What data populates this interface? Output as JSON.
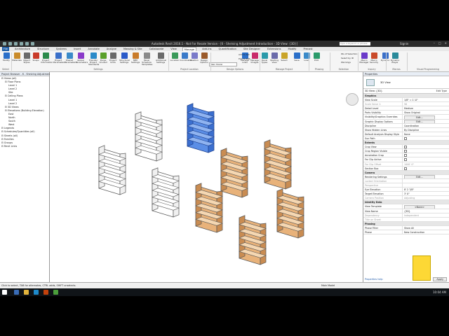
{
  "window": {
    "title": "Autodesk Revit 2016.1 - Not For Resale Version - [6 - Shelving Adjustment Introduction - 3D View: {3D}]",
    "search_placeholder": "Type a keyword or phrase",
    "user": "Signin"
  },
  "tabs": [
    "File",
    "Architecture",
    "Structure",
    "Systems",
    "Insert",
    "Annotate",
    "Analyze",
    "Massing & Site",
    "Collaborate",
    "View",
    "Manage",
    "Add-Ins",
    "Quantification",
    "Site Designer",
    "Extensions",
    "Modify",
    "Precast"
  ],
  "active_tab": "Manage",
  "ribbon": {
    "buttons": [
      {
        "label": "Modify"
      },
      {
        "label": "Materials"
      },
      {
        "label": "Object Styles"
      },
      {
        "label": "Snaps"
      },
      {
        "label": "Project Information"
      },
      {
        "label": "Project Parameters"
      },
      {
        "label": "Shared Parameters"
      },
      {
        "label": "Global Parameters"
      },
      {
        "label": "Transfer Project Standards"
      },
      {
        "label": "Purge Unused"
      },
      {
        "label": "Project Units"
      },
      {
        "label": "Structural Settings"
      },
      {
        "label": "MEP Settings"
      },
      {
        "label": "Panel Schedule Templates"
      },
      {
        "label": "Additional Settings"
      },
      {
        "label": "Location"
      },
      {
        "label": "Coordinates"
      },
      {
        "label": "Position"
      },
      {
        "label": "Design Options"
      },
      {
        "label": "Main Model"
      },
      {
        "label": "Manage Links"
      },
      {
        "label": "Manage Images"
      },
      {
        "label": "Decal Types"
      },
      {
        "label": "Starting View"
      },
      {
        "label": "Select"
      },
      {
        "label": "Save"
      },
      {
        "label": "Load"
      },
      {
        "label": "Edit"
      },
      {
        "label": "Macro Manager"
      },
      {
        "label": "Macro Security"
      },
      {
        "label": "Dynamo"
      },
      {
        "label": "Dynamo Player"
      }
    ],
    "small_items": [
      "Add to Set",
      "Pick to Edit",
      "IDs of Selection",
      "Select by ID",
      "Warnings"
    ],
    "groups": [
      "Select",
      "Settings",
      "Project Location",
      "Design Options",
      "Manage Project",
      "Phasing",
      "Selection",
      "Inquiry",
      "Macros",
      "Visual Programming"
    ]
  },
  "project_browser": {
    "title": "Project Browser - 6 - Shelving Adjustment Intro",
    "items": [
      {
        "label": "Views (all)",
        "level": 0
      },
      {
        "label": "Floor Plans",
        "level": 1
      },
      {
        "label": "Level 1",
        "level": 2
      },
      {
        "label": "Level 2",
        "level": 2
      },
      {
        "label": "Site",
        "level": 2
      },
      {
        "label": "Ceiling Plans",
        "level": 1
      },
      {
        "label": "Level 1",
        "level": 2
      },
      {
        "label": "Level 2",
        "level": 2
      },
      {
        "label": "3D Views",
        "level": 1
      },
      {
        "label": "Elevations (Building Elevation)",
        "level": 1
      },
      {
        "label": "East",
        "level": 2
      },
      {
        "label": "North",
        "level": 2
      },
      {
        "label": "South",
        "level": 2
      },
      {
        "label": "West",
        "level": 2
      },
      {
        "label": "Legends",
        "level": 0
      },
      {
        "label": "Schedules/Quantities (all)",
        "level": 0
      },
      {
        "label": "Sheets (all)",
        "level": 0
      },
      {
        "label": "Families",
        "level": 0
      },
      {
        "label": "Groups",
        "level": 0
      },
      {
        "label": "Revit Links",
        "level": 0
      }
    ]
  },
  "properties": {
    "title": "Properties",
    "type": "3D View",
    "view_selector": "3D View: {3D}",
    "edit_type": "Edit Type",
    "rows": [
      {
        "k": "Graphics",
        "v": "",
        "kind": "section"
      },
      {
        "k": "View Scale",
        "v": "1/8\" = 1'-0\"",
        "kind": "text"
      },
      {
        "k": "Scale Value  1:",
        "v": "96",
        "kind": "grey"
      },
      {
        "k": "Detail Level",
        "v": "Medium",
        "kind": "text"
      },
      {
        "k": "Parts Visibility",
        "v": "Show Original",
        "kind": "text"
      },
      {
        "k": "Visibility/Graphics Overrides",
        "v": "Edit...",
        "kind": "button"
      },
      {
        "k": "Graphic Display Options",
        "v": "Edit...",
        "kind": "button"
      },
      {
        "k": "Discipline",
        "v": "Coordination",
        "kind": "text"
      },
      {
        "k": "Show Hidden Lines",
        "v": "By Discipline",
        "kind": "text"
      },
      {
        "k": "Default Analysis Display Style",
        "v": "None",
        "kind": "text"
      },
      {
        "k": "Sun Path",
        "v": "",
        "kind": "check"
      },
      {
        "k": "Extents",
        "v": "",
        "kind": "section"
      },
      {
        "k": "Crop View",
        "v": "",
        "kind": "check"
      },
      {
        "k": "Crop Region Visible",
        "v": "",
        "kind": "check"
      },
      {
        "k": "Annotation Crop",
        "v": "",
        "kind": "check"
      },
      {
        "k": "Far Clip Active",
        "v": "",
        "kind": "check"
      },
      {
        "k": "Far Clip Offset",
        "v": "1000' 0\"",
        "kind": "grey"
      },
      {
        "k": "Section Box",
        "v": "",
        "kind": "check"
      },
      {
        "k": "Camera",
        "v": "",
        "kind": "section"
      },
      {
        "k": "Rendering Settings",
        "v": "Edit...",
        "kind": "button"
      },
      {
        "k": "Locked Orientation",
        "v": "",
        "kind": "grey"
      },
      {
        "k": "Perspective",
        "v": "",
        "kind": "grey"
      },
      {
        "k": "Eye Elevation",
        "v": "8' 2 7/8\"",
        "kind": "text"
      },
      {
        "k": "Target Elevation",
        "v": "3' 0\"",
        "kind": "text"
      },
      {
        "k": "Camera Position",
        "v": "Adjusting",
        "kind": "grey"
      },
      {
        "k": "Identity Data",
        "v": "",
        "kind": "section"
      },
      {
        "k": "View Template",
        "v": "<None>",
        "kind": "button"
      },
      {
        "k": "View Name",
        "v": "{3D}",
        "kind": "text"
      },
      {
        "k": "Dependency",
        "v": "Independent",
        "kind": "grey"
      },
      {
        "k": "Title on Sheet",
        "v": "",
        "kind": "grey"
      },
      {
        "k": "Phasing",
        "v": "",
        "kind": "section"
      },
      {
        "k": "Phase Filter",
        "v": "Show All",
        "kind": "text"
      },
      {
        "k": "Phase",
        "v": "New Construction",
        "kind": "text"
      }
    ],
    "help": "Properties help",
    "apply": "Apply"
  },
  "status": {
    "text": "Click to select, TAB for alternates, CTRL adds, SHIFT unselects.",
    "model": "Main Model"
  },
  "clock": "10:04 AM",
  "colors": {
    "accent": "#1f5fa8",
    "wood": "#e8b27a",
    "selected": "#5b8ee6"
  },
  "shelves": [
    {
      "id": "white-1",
      "style": "white"
    },
    {
      "id": "white-2",
      "style": "white"
    },
    {
      "id": "white-3",
      "style": "white"
    },
    {
      "id": "selected-1",
      "style": "selected"
    },
    {
      "id": "wood-1",
      "style": "wood"
    },
    {
      "id": "wood-2",
      "style": "wood"
    },
    {
      "id": "wood-3",
      "style": "wood"
    },
    {
      "id": "wood-4",
      "style": "wood"
    },
    {
      "id": "wood-5",
      "style": "wood"
    }
  ]
}
